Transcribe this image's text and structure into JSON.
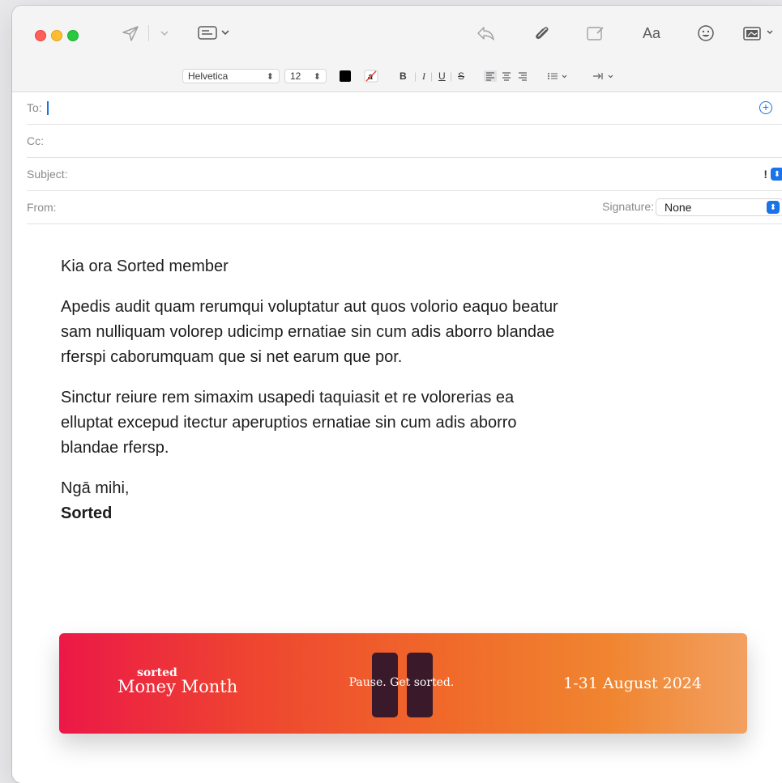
{
  "toolbar": {
    "icons": [
      "send-icon",
      "chevron-down-icon",
      "header-fields-icon",
      "reply-icon",
      "attachment-icon",
      "markup-icon",
      "format-fonts-icon",
      "emoji-icon",
      "photo-browser-icon"
    ],
    "fonts_label": "Aa"
  },
  "format_bar": {
    "font_family": "Helvetica",
    "font_size": "12",
    "text_color": "#000000",
    "bold": "B",
    "italic": "I",
    "underline": "U",
    "strikethrough": "S"
  },
  "fields": {
    "to_label": "To:",
    "cc_label": "Cc:",
    "subject_label": "Subject:",
    "from_label": "From:",
    "priority": "!",
    "signature_label": "Signature:",
    "signature_value": "None"
  },
  "message": {
    "greeting": "Kia ora Sorted member",
    "paragraph1": "Apedis audit quam rerumqui voluptatur aut quos volorio eaquo beatur sam nulliquam volorep udicimp ernatiae sin cum adis aborro blandae rferspi caborumquam que si net earum que por.",
    "paragraph2": "Sinctur reiure rem simaxim usapedi taquiasit et re volorerias ea elluptat excepud itectur aperuptios ernatiae sin cum adis aborro blandae rfersp.",
    "closing": "Ngā mihi,",
    "sender": "Sorted"
  },
  "banner": {
    "brand_small": "sorted",
    "brand_big": "Money Month",
    "tagline": "Pause. Get sorted.",
    "dates": "1-31 August 2024",
    "colors": {
      "start": "#ec1847",
      "end": "#f2a061",
      "pause": "#3a1a2a"
    }
  },
  "accent_color": "#1a73e8"
}
